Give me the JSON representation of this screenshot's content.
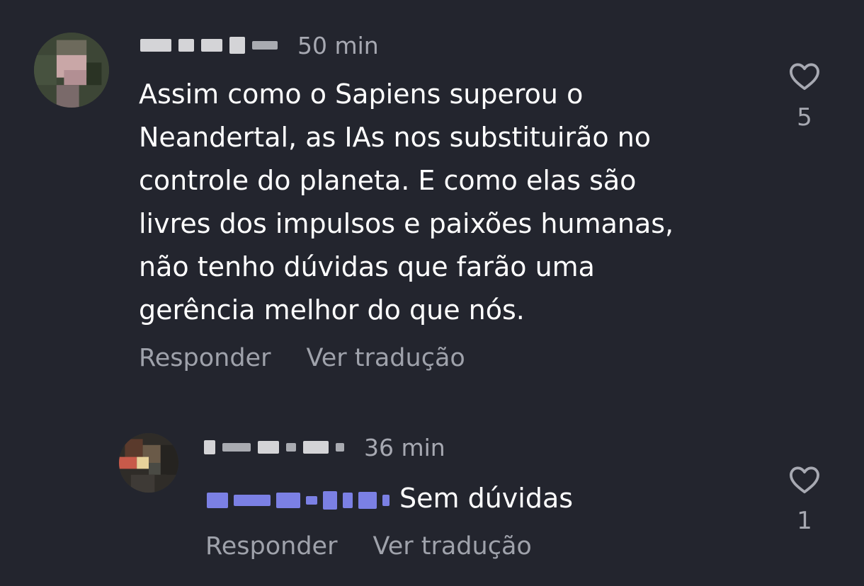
{
  "colors": {
    "background": "#23252e",
    "text_primary": "#ffffff",
    "text_secondary": "#a7a9b2",
    "mention": "#7b80e4"
  },
  "comments": [
    {
      "time": "50 min",
      "text_lines": [
        "Assim como o Sapiens superou o",
        "Neandertal, as IAs nos substituirão no",
        "controle do planeta. E como elas são",
        "livres dos impulsos e paixões humanas,",
        "não tenho dúvidas que farão uma",
        "gerência melhor do que nós."
      ],
      "actions": {
        "reply_label": "Responder",
        "translate_label": "Ver tradução"
      },
      "like": {
        "icon": "heart-outline-icon",
        "count": "5"
      }
    },
    {
      "time": "36 min",
      "text": "Sem dúvidas",
      "actions": {
        "reply_label": "Responder",
        "translate_label": "Ver tradução"
      },
      "like": {
        "icon": "heart-outline-icon",
        "count": "1"
      }
    }
  ]
}
